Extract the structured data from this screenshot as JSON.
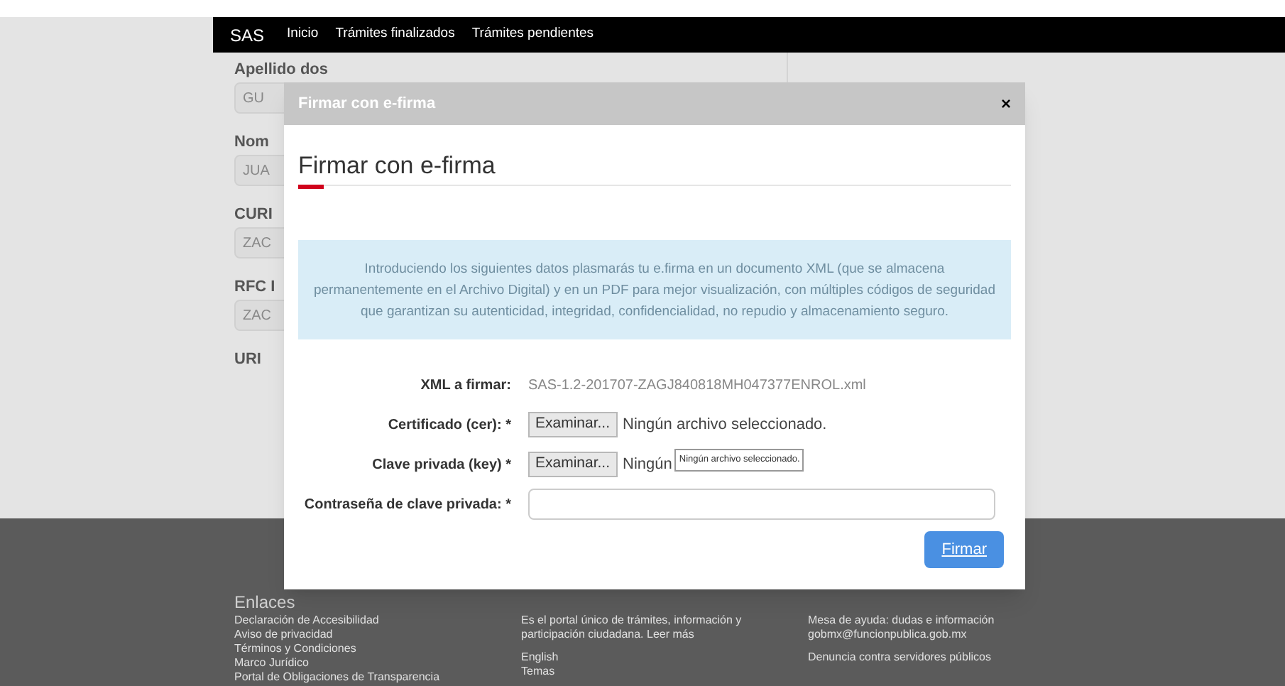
{
  "navbar": {
    "brand": "SAS",
    "links": [
      "Inicio",
      "Trámites finalizados",
      "Trámites pendientes"
    ]
  },
  "background_form": [
    {
      "label": "Apellido dos",
      "value": "GU"
    },
    {
      "label": "Nom",
      "value": "JUA"
    },
    {
      "label": "CURI",
      "value": "ZAC"
    },
    {
      "label": "RFC I",
      "value": "ZAC"
    },
    {
      "label": "URI"
    }
  ],
  "modal": {
    "header": "Firmar con e-firma",
    "title": "Firmar con e-firma",
    "close": "×",
    "info": "Introduciendo los siguientes datos plasmarás tu e.firma en un documento XML (que se almacena permanentemente en el Archivo Digital) y en un PDF para mejor visualización, con múltiples códigos de seguridad que garantizan su autenticidad, integridad, confidencialidad, no repudio y almacenamiento seguro.",
    "rows": [
      {
        "kind": "text",
        "label": "XML a firmar:",
        "value": "SAS-1.2-201707-ZAGJ840818MH047377ENROL.xml"
      },
      {
        "kind": "file",
        "label": "Certificado (cer): *",
        "button": "Examinar...",
        "status": "Ningún archivo seleccionado."
      },
      {
        "kind": "file",
        "label": "Clave privada (key) *",
        "button": "Examinar...",
        "status": "Ningún",
        "tooltip": "Ningún archivo seleccionado."
      },
      {
        "kind": "input",
        "label": "Contraseña de clave privada: *"
      }
    ],
    "submit": "Firmar"
  },
  "footer": {
    "heading": "Enlaces",
    "columns": [
      [
        "Declaración de Accesibilidad",
        "Aviso de privacidad",
        "Términos y Condiciones",
        "Marco Jurídico",
        "Portal de Obligaciones de Transparencia"
      ],
      [
        "Es el portal único de trámites, información y participación ciudadana. Leer más",
        "English",
        "Temas"
      ],
      [
        "Mesa de ayuda: dudas e información gobmx@funcionpublica.gob.mx",
        "Denuncia contra servidores públicos"
      ]
    ]
  }
}
